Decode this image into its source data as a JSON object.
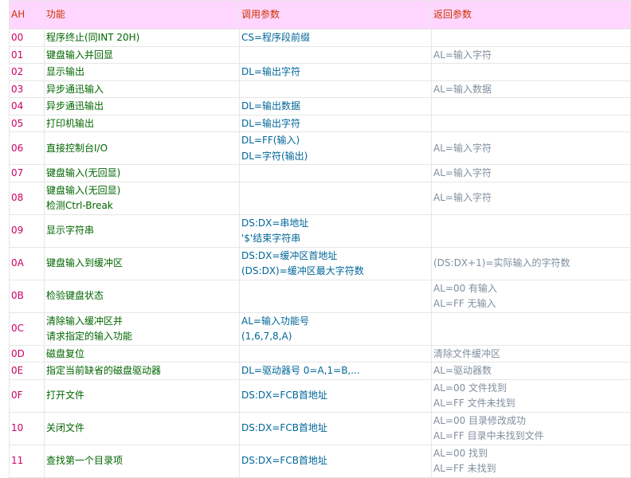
{
  "table": {
    "headers": {
      "ah": "AH",
      "function": "功能",
      "input": "调用参数",
      "output": "返回参数"
    },
    "rows": [
      {
        "ah": "00",
        "function": [
          "程序终止(同INT 20H)"
        ],
        "input": [
          "CS=程序段前缀"
        ],
        "output": []
      },
      {
        "ah": "01",
        "function": [
          "键盘输入并回显"
        ],
        "input": [],
        "output": [
          "AL=输入字符"
        ]
      },
      {
        "ah": "02",
        "function": [
          "显示输出"
        ],
        "input": [
          "DL=输出字符"
        ],
        "output": []
      },
      {
        "ah": "03",
        "function": [
          "异步通迅输入"
        ],
        "input": [],
        "output": [
          "AL=输入数据"
        ]
      },
      {
        "ah": "04",
        "function": [
          "异步通迅输出"
        ],
        "input": [
          "DL=输出数据"
        ],
        "output": []
      },
      {
        "ah": "05",
        "function": [
          "打印机输出"
        ],
        "input": [
          "DL=输出字符"
        ],
        "output": []
      },
      {
        "ah": "06",
        "function": [
          "直接控制台I/O"
        ],
        "input": [
          "DL=FF(输入)",
          "DL=字符(输出)"
        ],
        "output": [
          "AL=输入字符"
        ]
      },
      {
        "ah": "07",
        "function": [
          "键盘输入(无回显)"
        ],
        "input": [],
        "output": [
          "AL=输入字符"
        ]
      },
      {
        "ah": "08",
        "function": [
          "键盘输入(无回显)",
          "检测Ctrl-Break"
        ],
        "input": [],
        "output": [
          "AL=输入字符"
        ]
      },
      {
        "ah": "09",
        "function": [
          "显示字符串"
        ],
        "input": [
          "DS:DX=串地址",
          "'$'结束字符串"
        ],
        "output": []
      },
      {
        "ah": "0A",
        "function": [
          "键盘输入到缓冲区"
        ],
        "input": [
          "DS:DX=缓冲区首地址",
          "(DS:DX)=缓冲区最大字符数"
        ],
        "output": [
          "(DS:DX+1)=实际输入的字符数"
        ]
      },
      {
        "ah": "0B",
        "function": [
          "检验键盘状态"
        ],
        "input": [],
        "output": [
          "AL=00 有输入",
          "AL=FF 无输入"
        ]
      },
      {
        "ah": "0C",
        "function": [
          "清除输入缓冲区并",
          "请求指定的输入功能"
        ],
        "input": [
          "AL=输入功能号",
          "(1,6,7,8,A)"
        ],
        "output": []
      },
      {
        "ah": "0D",
        "function": [
          "磁盘复位"
        ],
        "input": [],
        "output": [
          "清除文件缓冲区"
        ]
      },
      {
        "ah": "0E",
        "function": [
          "指定当前缺省的磁盘驱动器"
        ],
        "input": [
          "DL=驱动器号 0=A,1=B,..."
        ],
        "output": [
          "AL=驱动器数"
        ]
      },
      {
        "ah": "0F",
        "function": [
          "打开文件"
        ],
        "input": [
          "DS:DX=FCB首地址"
        ],
        "output": [
          "AL=00 文件找到",
          "AL=FF 文件未找到"
        ]
      },
      {
        "ah": "10",
        "function": [
          "关闭文件"
        ],
        "input": [
          "DS:DX=FCB首地址"
        ],
        "output": [
          "AL=00 目录修改成功",
          "AL=FF 目录中未找到文件"
        ]
      },
      {
        "ah": "11",
        "function": [
          "查找第一个目录项"
        ],
        "input": [
          "DS:DX=FCB首地址"
        ],
        "output": [
          "AL=00 找到",
          "AL=FF 未找到"
        ]
      }
    ]
  }
}
